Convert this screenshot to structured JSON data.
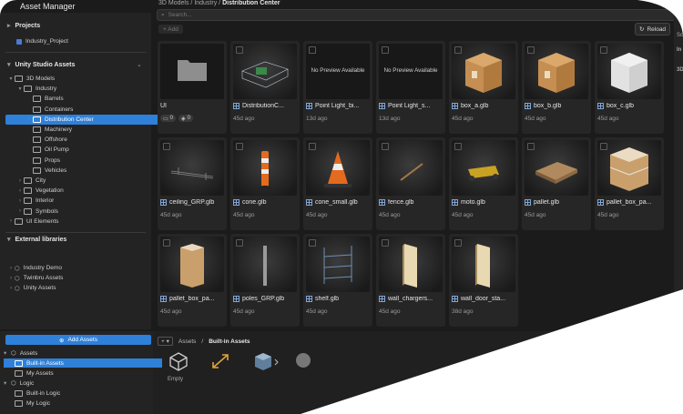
{
  "app": {
    "title": "Asset Manager"
  },
  "sidebar": {
    "projects_label": "Projects",
    "project_name": "Industry_Project",
    "unity_assets_label": "Unity Studio Assets",
    "tree": [
      {
        "label": "3D Models",
        "depth": 0,
        "expanded": true
      },
      {
        "label": "Industry",
        "depth": 1,
        "expanded": true
      },
      {
        "label": "Barrels",
        "depth": 2
      },
      {
        "label": "Containers",
        "depth": 2
      },
      {
        "label": "Distribution Center",
        "depth": 2,
        "selected": true,
        "has_children": true
      },
      {
        "label": "Machinery",
        "depth": 2
      },
      {
        "label": "Offshore",
        "depth": 2
      },
      {
        "label": "Oil Pump",
        "depth": 2
      },
      {
        "label": "Props",
        "depth": 2
      },
      {
        "label": "Vehicles",
        "depth": 2
      },
      {
        "label": "City",
        "depth": 1,
        "has_children": true
      },
      {
        "label": "Vegetation",
        "depth": 1,
        "has_children": true
      },
      {
        "label": "Interior",
        "depth": 1,
        "has_children": true
      },
      {
        "label": "Symbols",
        "depth": 1,
        "has_children": true
      },
      {
        "label": "UI Elements",
        "depth": 0,
        "has_children": true
      }
    ],
    "external_label": "External libraries",
    "external": [
      "Industry Demo",
      "Twinbru Assets",
      "Unity Assets"
    ]
  },
  "main": {
    "breadcrumb": [
      "3D Models",
      "Industry",
      "Distribution Center"
    ],
    "search_placeholder": "Search...",
    "add_label": "+ Add",
    "reload_label": "Reload",
    "assets": [
      {
        "name": "UI",
        "kind": "folder",
        "badges": [
          "0",
          "0"
        ]
      },
      {
        "name": "DistributionC...",
        "kind": "model",
        "date": "45d ago",
        "preview": "wire"
      },
      {
        "name": "Point Light_bi...",
        "kind": "model",
        "date": "13d ago",
        "preview": "none",
        "preview_text": "No Preview Available"
      },
      {
        "name": "Point Light_s...",
        "kind": "model",
        "date": "13d ago",
        "preview": "none",
        "preview_text": "No Preview Available"
      },
      {
        "name": "box_a.glb",
        "kind": "model",
        "date": "45d ago",
        "preview": "box_brown"
      },
      {
        "name": "box_b.glb",
        "kind": "model",
        "date": "45d ago",
        "preview": "box_brown"
      },
      {
        "name": "box_c.glb",
        "kind": "model",
        "date": "45d ago",
        "preview": "box_white"
      },
      {
        "name": "ceiling_GRP.glb",
        "kind": "model",
        "date": "45d ago",
        "preview": "ceiling"
      },
      {
        "name": "cone.glb",
        "kind": "model",
        "date": "45d ago",
        "preview": "bollard"
      },
      {
        "name": "cone_small.glb",
        "kind": "model",
        "date": "45d ago",
        "preview": "cone"
      },
      {
        "name": "fence.glb",
        "kind": "model",
        "date": "45d ago",
        "preview": "fence"
      },
      {
        "name": "moto.glb",
        "kind": "model",
        "date": "45d ago",
        "preview": "moto"
      },
      {
        "name": "pallet.glb",
        "kind": "model",
        "date": "45d ago",
        "preview": "pallet"
      },
      {
        "name": "pallet_box_pa...",
        "kind": "model",
        "date": "45d ago",
        "preview": "pallet_stack"
      },
      {
        "name": "pallet_box_pa...",
        "kind": "model",
        "date": "45d ago",
        "preview": "pallet_tall"
      },
      {
        "name": "poles_GRP.glb",
        "kind": "model",
        "date": "45d ago",
        "preview": "pole"
      },
      {
        "name": "shelf.glb",
        "kind": "model",
        "date": "45d ago",
        "preview": "shelf"
      },
      {
        "name": "wall_chargers...",
        "kind": "model",
        "date": "45d ago",
        "preview": "wall"
      },
      {
        "name": "wall_door_sta...",
        "kind": "model",
        "date": "38d ago",
        "preview": "wall"
      }
    ]
  },
  "bottom": {
    "add_assets_label": "Add Assets",
    "tree": [
      {
        "label": "Assets",
        "depth": 0,
        "expanded": true
      },
      {
        "label": "Built-in Assets",
        "depth": 1,
        "selected": true
      },
      {
        "label": "My Assets",
        "depth": 1
      },
      {
        "label": "Logic",
        "depth": 0,
        "expanded": true
      },
      {
        "label": "Built-in Logic",
        "depth": 1
      },
      {
        "label": "My Logic",
        "depth": 1
      }
    ],
    "breadcrumb": [
      "Assets",
      "Built-in Assets"
    ],
    "plus_label": "+ ▾",
    "first_item": "Empty"
  },
  "right_panel": {
    "labels": [
      "Sc",
      "In",
      "3D"
    ]
  },
  "colors": {
    "accent": "#2f80d9",
    "background": "#1b1b1b",
    "panel": "#232323"
  }
}
